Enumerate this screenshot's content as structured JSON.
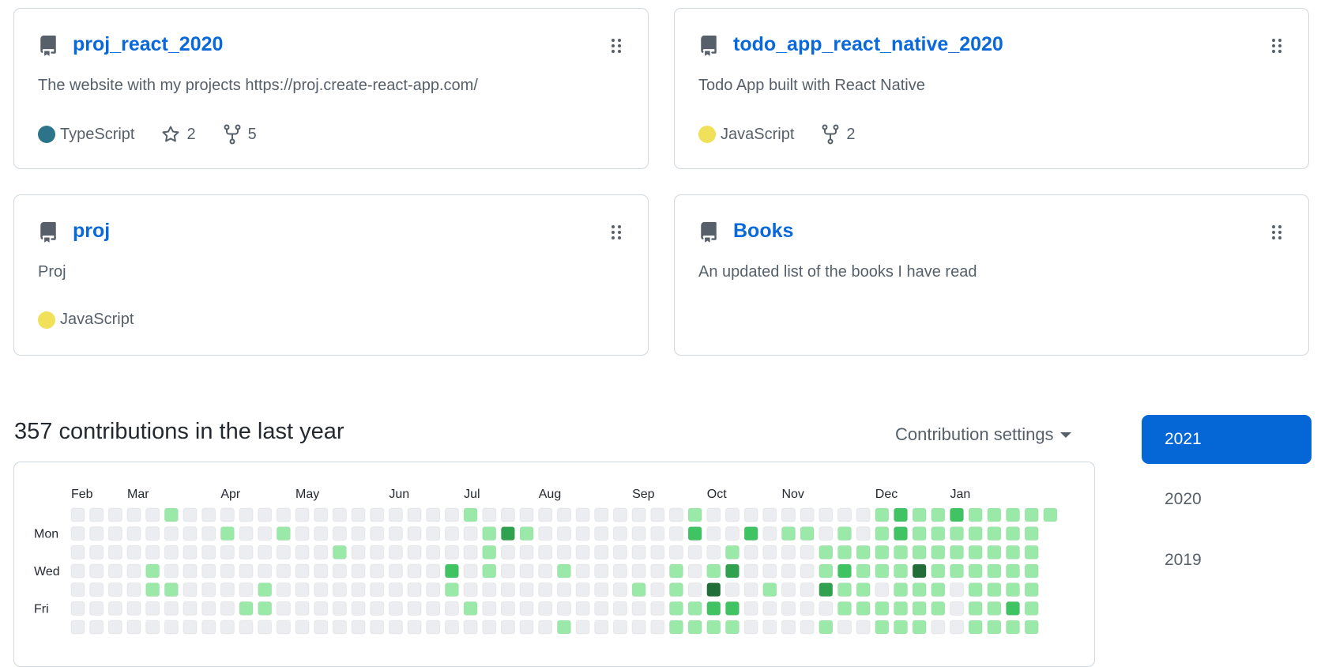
{
  "repos": [
    {
      "name": "proj_react_2020",
      "description": "The website with my projects https://proj.create-react-app.com/",
      "language": "TypeScript",
      "language_color": "#2b7489",
      "stars": "2",
      "forks": "5"
    },
    {
      "name": "todo_app_react_native_2020",
      "description": "Todo App built with React Native",
      "language": "JavaScript",
      "language_color": "#f1e05a",
      "forks": "2"
    },
    {
      "name": "proj",
      "description": "Proj",
      "language": "JavaScript",
      "language_color": "#f1e05a"
    },
    {
      "name": "Books",
      "description": "An updated list of the books I have read"
    }
  ],
  "contributions": {
    "title": "357 contributions in the last year",
    "settings_label": "Contribution settings",
    "months": [
      {
        "label": "Feb",
        "week": 0
      },
      {
        "label": "Mar",
        "week": 3
      },
      {
        "label": "Apr",
        "week": 8
      },
      {
        "label": "May",
        "week": 12
      },
      {
        "label": "Jun",
        "week": 17
      },
      {
        "label": "Jul",
        "week": 21
      },
      {
        "label": "Aug",
        "week": 25
      },
      {
        "label": "Sep",
        "week": 30
      },
      {
        "label": "Oct",
        "week": 34
      },
      {
        "label": "Nov",
        "week": 38
      },
      {
        "label": "Dec",
        "week": 43
      },
      {
        "label": "Jan",
        "week": 47
      }
    ],
    "day_labels": [
      "",
      "Mon",
      "",
      "Wed",
      "",
      "Fri",
      ""
    ],
    "level_colors": [
      "#ebedf0",
      "#9be9a8",
      "#40c463",
      "#30a14e",
      "#216e39"
    ],
    "levels_by_day": [
      "00000100000000000000010000000000010000000001211211111",
      "0000000010010000000000131000000002002011010121111111-",
      "0000000000000010000000100000000000010000111111111111-",
      "0000100000000000000020100010000010130000121114111111-",
      "0000110000100000000010000000001010400100311011101111-",
      "0000000001100000000001000000000011220000011111101121-",
      "0000000000000000000000000010000011110000100111001111-"
    ]
  },
  "years": [
    {
      "label": "2021",
      "active": true
    },
    {
      "label": "2020",
      "active": false
    },
    {
      "label": "2019",
      "active": false
    }
  ]
}
